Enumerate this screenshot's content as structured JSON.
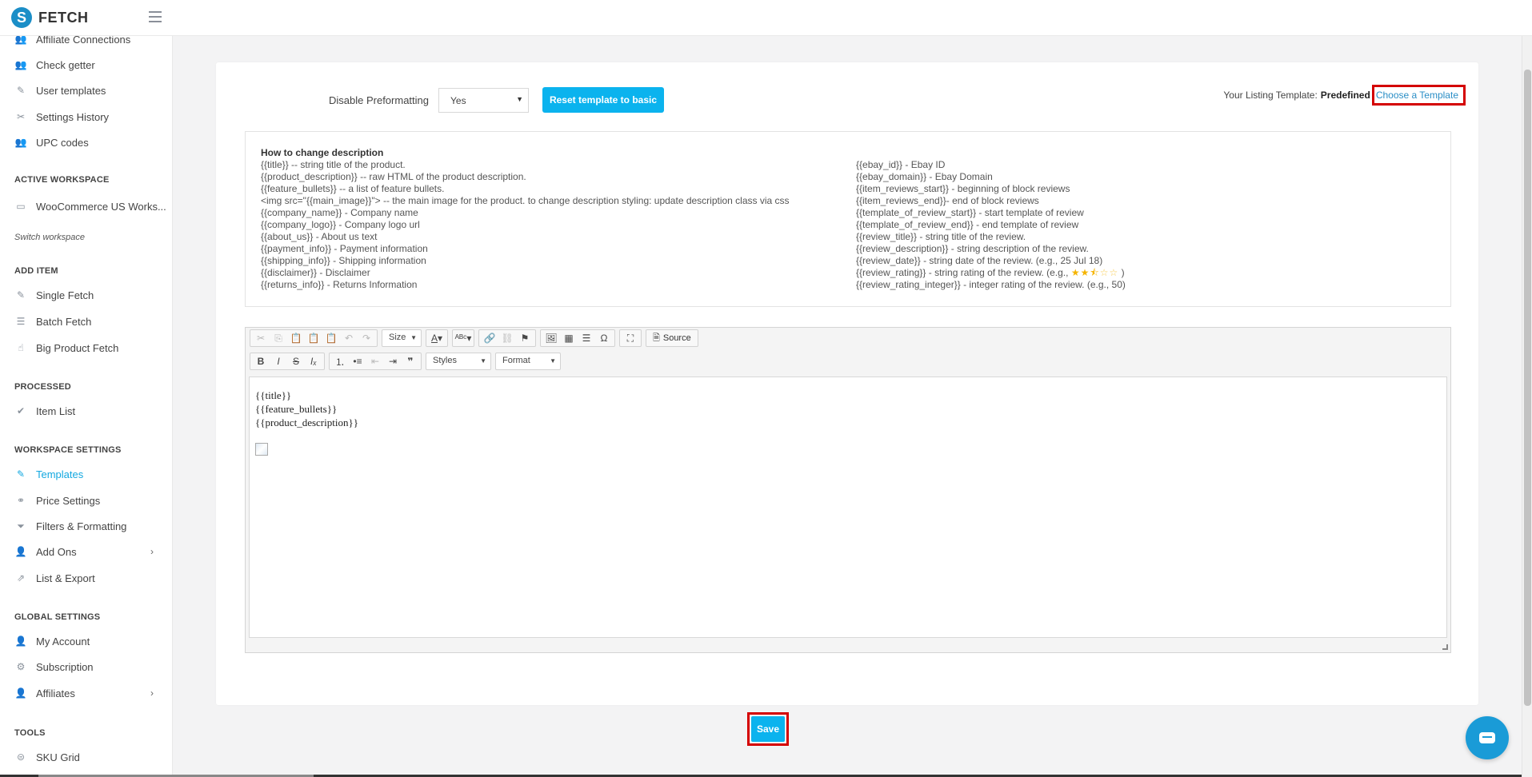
{
  "app": {
    "name": "FETCH",
    "logo_glyph": "S"
  },
  "sidebar": {
    "top_items": [
      {
        "label": "Affiliate Connections",
        "icon": "users-icon"
      },
      {
        "label": "Check getter",
        "icon": "users-icon"
      },
      {
        "label": "User templates",
        "icon": "brush-icon"
      },
      {
        "label": "Settings History",
        "icon": "tools-icon"
      },
      {
        "label": "UPC codes",
        "icon": "users-icon"
      }
    ],
    "active_workspace": {
      "heading": "ACTIVE WORKSPACE",
      "name": "WooCommerce US Works...",
      "switch_label": "Switch workspace"
    },
    "add_item": {
      "heading": "ADD ITEM",
      "items": [
        "Single Fetch",
        "Batch Fetch",
        "Big Product Fetch"
      ]
    },
    "processed": {
      "heading": "PROCESSED",
      "items": [
        "Item List"
      ]
    },
    "workspace_settings": {
      "heading": "WORKSPACE SETTINGS",
      "items": [
        "Templates",
        "Price Settings",
        "Filters & Formatting",
        "Add Ons",
        "List & Export"
      ],
      "active": "Templates"
    },
    "global_settings": {
      "heading": "GLOBAL SETTINGS",
      "items": [
        "My Account",
        "Subscription",
        "Affiliates"
      ]
    },
    "tools": {
      "heading": "TOOLS",
      "items": [
        "SKU Grid"
      ]
    }
  },
  "template_settings": {
    "disable_preformatting_label": "Disable Preformatting",
    "disable_preformatting_value": "Yes",
    "reset_button": "Reset template to basic",
    "listing_template_label": "Your Listing Template:",
    "listing_template_value": "Predefined",
    "choose_template_link": "Choose a Template"
  },
  "help": {
    "title": "How to change description",
    "left_lines": [
      "{{title}} -- string title of the product.",
      "{{product_description}} -- raw HTML of the product description.",
      "{{feature_bullets}} -- a list of feature bullets.",
      "<img src=\"{{main_image}}\"> -- the main image for the product. to change description styling: update description class via css",
      "{{company_name}} - Company name",
      "{{company_logo}} - Company logo url",
      "{{about_us}} - About us text",
      "{{payment_info}} - Payment information",
      "{{shipping_info}} - Shipping information",
      "{{disclaimer}} - Disclaimer",
      "{{returns_info}} - Returns Information"
    ],
    "right_lines": [
      "{{ebay_id}} - Ebay ID",
      "{{ebay_domain}} - Ebay Domain",
      "{{item_reviews_start}} - beginning of block reviews",
      "{{item_reviews_end}}- end of block reviews",
      "{{template_of_review_start}} - start template of review",
      "{{template_of_review_end}} - end template of review",
      "{{review_title}} - string title of the review.",
      "{{review_description}} - string description of the review.",
      "{{review_date}} - string date of the review. (e.g., 25 Jul 18)"
    ],
    "review_rating_prefix": "{{review_rating}} - string rating of the review. (e.g.,",
    "review_rating_suffix": ")",
    "review_rating_example": 2.5,
    "review_rating_integer_line": "{{review_rating_integer}} - integer rating of the review. (e.g., 50)"
  },
  "editor": {
    "toolbar": {
      "size_label": "Size",
      "styles_label": "Styles",
      "format_label": "Format",
      "source_label": "Source"
    },
    "content_lines": [
      "{{title}}",
      "{{feature_bullets}}",
      "{{product_description}}"
    ]
  },
  "actions": {
    "save_label": "Save"
  },
  "colors": {
    "accent": "#0bb3ee",
    "highlight_border": "#d40000",
    "link": "#2a8ec6"
  }
}
